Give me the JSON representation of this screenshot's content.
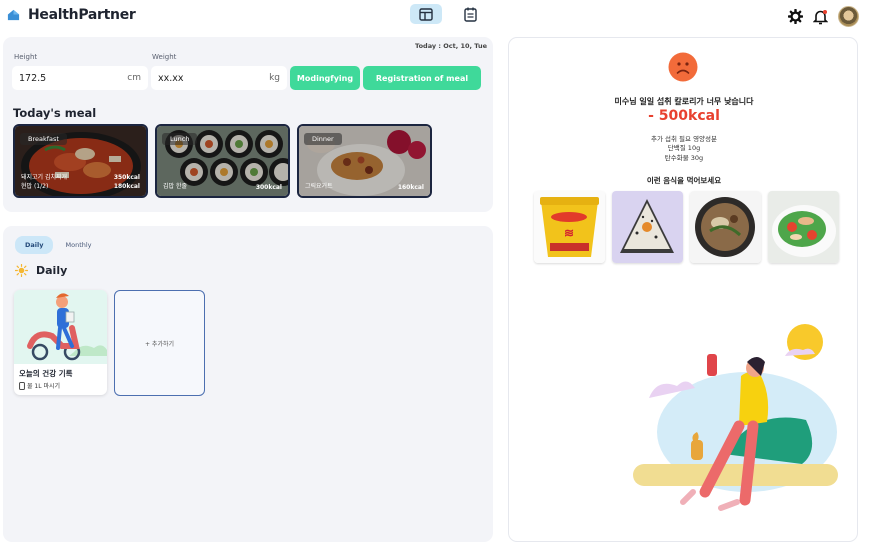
{
  "app": {
    "name": "HealthPartner"
  },
  "icons": {
    "logo": "heart-icon",
    "layout": "layout-icon",
    "calendar": "calendar-icon",
    "settings": "gear-icon",
    "notification": "bell-icon"
  },
  "colors": {
    "accent": "#3fd99a",
    "warning": "#e8412f",
    "tab_active": "#cce7f8",
    "meal_border": "#1b2540"
  },
  "header": {
    "date": "Today : Oct, 10, Tue"
  },
  "height": {
    "label": "Height",
    "value": "172.5",
    "unit": "cm"
  },
  "weight": {
    "label": "Weight",
    "value": "xx.xx",
    "unit": "kg"
  },
  "buttons": {
    "modify": "Modingfying",
    "register": "Registration of meal"
  },
  "meals": {
    "title": "Today's meal",
    "items": [
      {
        "tag": "Breakfast",
        "line1": "돼지고기 김치찌개",
        "line2": "현밥 (1/2)",
        "kcal1": "350kcal",
        "kcal2": "180kcal"
      },
      {
        "tag": "Lunch",
        "line1": "김밥 한줄",
        "line2": "",
        "kcal1": "300kcal",
        "kcal2": ""
      },
      {
        "tag": "Dinner",
        "line1": "그릭요거트",
        "line2": "",
        "kcal1": "160kcal",
        "kcal2": ""
      }
    ]
  },
  "records": {
    "tabs": [
      "Daily",
      "Monthly"
    ],
    "active_tab": "Daily",
    "heading": "Daily",
    "card": {
      "title": "오늘의 건강 기록",
      "subtitle": "물 1L 마시기"
    },
    "add_label": "+ 추가하기"
  },
  "advice": {
    "message": "미수님 일일 섭취 칼로리가 너무 낮습니다",
    "deficit": "- 500kcal",
    "nutrients_title": "추가 섭취 필요 영양성분",
    "nutrients": [
      "단백질 10g",
      "탄수화물 30g"
    ],
    "suggest_title": "이런 음식을 먹어보세요"
  }
}
